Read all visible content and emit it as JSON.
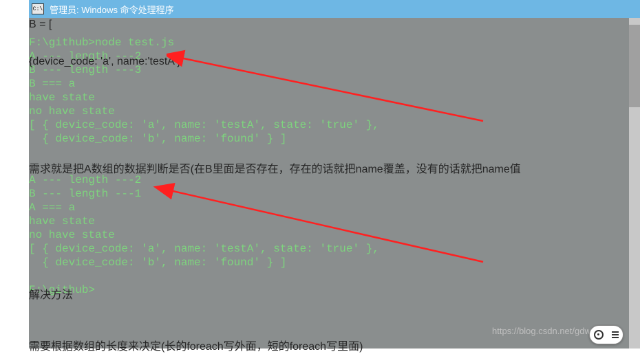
{
  "titleBar": {
    "iconText": "C:\\",
    "title": "管理员: Windows 命令处理程序"
  },
  "overlays": {
    "b_array": "B = [",
    "device_a": "{device_code: 'a', name:'testA'}",
    "requirement": "需求就是把A数组的数据判断是否(在B里面是否存在，存在的话就把name覆盖，没有的话就把name值",
    "solution": "解决方法",
    "bottom": "需要根据数组的长度来决定(长的foreach写外面，短的foreach写里面)"
  },
  "terminal": {
    "lines": [
      "",
      "F:\\github>node test.js",
      "A --- length ---2",
      "B --- length ---3",
      "B === a",
      "have state",
      "no have state",
      "[ { device_code: 'a', name: 'testA', state: 'true' },",
      "  { device_code: 'b', name: 'found' } ]",
      "",
      "",
      "A --- length ---2",
      "B --- length ---1",
      "A === a",
      "have state",
      "no have state",
      "[ { device_code: 'a', name: 'testA', state: 'true' },",
      "  { device_code: 'b', name: 'found' } ]",
      "",
      "F:\\github>"
    ]
  },
  "watermark": "https://blog.csdn.net/gdwLAe"
}
